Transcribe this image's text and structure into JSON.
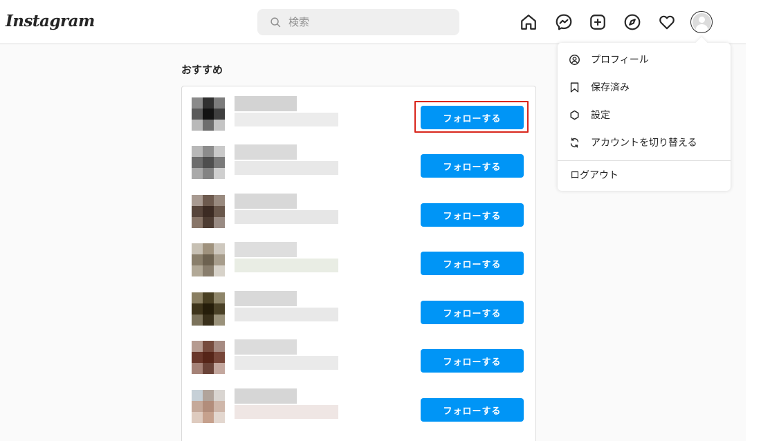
{
  "header": {
    "logo": "Instagram",
    "search_placeholder": "検索"
  },
  "suggestions": {
    "title": "おすすめ",
    "follow_label": "フォローする",
    "rows": [
      {
        "avatar": [
          "#8a8a8a",
          "#303030",
          "#7c7c7c",
          "#5a5a5a",
          "#121212",
          "#3f3f3f",
          "#b9b9b9",
          "#6e6e6e",
          "#c4c4c4"
        ],
        "name": [
          "#d3d3d3",
          "#ececec"
        ]
      },
      {
        "avatar": [
          "#b8b8b8",
          "#8c8c8c",
          "#c9c9c9",
          "#6d6d6d",
          "#4e4e4e",
          "#7a7a7a",
          "#a9a9a9",
          "#838383",
          "#cfcfcf"
        ],
        "name": [
          "#dadada",
          "#e8e8e8"
        ]
      },
      {
        "avatar": [
          "#a99a90",
          "#6f5a4c",
          "#9a8a7e",
          "#59453a",
          "#3d2b22",
          "#6b5749",
          "#8a7566",
          "#4f3c31",
          "#9a8b82"
        ],
        "name": [
          "#d8d8d8",
          "#e6e6e6"
        ]
      },
      {
        "avatar": [
          "#c8c0b2",
          "#a0927a",
          "#cfc8bd",
          "#8b7f69",
          "#6e624e",
          "#a89d8a",
          "#b3a995",
          "#8a7e6b",
          "#d7d2c8"
        ],
        "name": [
          "#dedede",
          "#e9ede4"
        ]
      },
      {
        "avatar": [
          "#8a7e5e",
          "#4a3f20",
          "#8f8566",
          "#3f3418",
          "#261d08",
          "#4b4124",
          "#7c7258",
          "#3a3019",
          "#9b9278"
        ],
        "name": [
          "#d9d9d9",
          "#e8e8e8"
        ]
      },
      {
        "avatar": [
          "#b89a8e",
          "#7a4a3a",
          "#a88a80",
          "#6e3627",
          "#5a2416",
          "#7b4536",
          "#a88175",
          "#6e4236",
          "#c6a69c"
        ],
        "name": [
          "#dcdcdc",
          "#eaeaea"
        ]
      },
      {
        "avatar": [
          "#c5d0d8",
          "#b2a49a",
          "#d9d5d0",
          "#c8a898",
          "#b58c78",
          "#d1b7a8",
          "#e0cbbd",
          "#c9a08a",
          "#e4d7ce"
        ],
        "name": [
          "#d6d6d6",
          "#efe6e4"
        ]
      }
    ]
  },
  "menu": {
    "items": [
      {
        "label": "プロフィール",
        "icon": "profile-icon"
      },
      {
        "label": "保存済み",
        "icon": "bookmark-icon"
      },
      {
        "label": "設定",
        "icon": "gear-icon"
      },
      {
        "label": "アカウントを切り替える",
        "icon": "switch-icon"
      }
    ],
    "logout": "ログアウト"
  },
  "colors": {
    "accent": "#0095f6",
    "highlight": "#d9261c"
  }
}
